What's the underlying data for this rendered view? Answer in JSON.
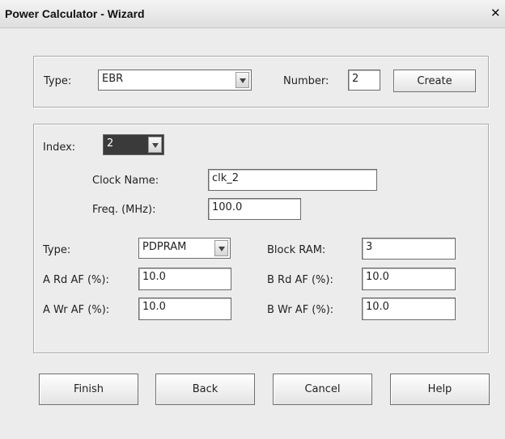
{
  "window": {
    "title": "Power Calculator - Wizard",
    "close_glyph": "✕"
  },
  "top": {
    "type_label": "Type:",
    "type_value": "EBR",
    "number_label": "Number:",
    "number_value": "2",
    "create_label": "Create"
  },
  "detail": {
    "index_label": "Index:",
    "index_value": "2",
    "clock_name_label": "Clock Name:",
    "clock_name_value": "clk_2",
    "freq_label": "Freq. (MHz):",
    "freq_value": "100.0",
    "type_label": "Type:",
    "type_value": "PDPRAM",
    "block_ram_label": "Block RAM:",
    "block_ram_value": "3",
    "a_rd_label": "A Rd AF (%):",
    "a_rd_value": "10.0",
    "b_rd_label": "B Rd AF (%):",
    "b_rd_value": "10.0",
    "a_wr_label": "A Wr AF (%):",
    "a_wr_value": "10.0",
    "b_wr_label": "B Wr AF (%):",
    "b_wr_value": "10.0"
  },
  "buttons": {
    "finish": "Finish",
    "back": "Back",
    "cancel": "Cancel",
    "help": "Help"
  }
}
